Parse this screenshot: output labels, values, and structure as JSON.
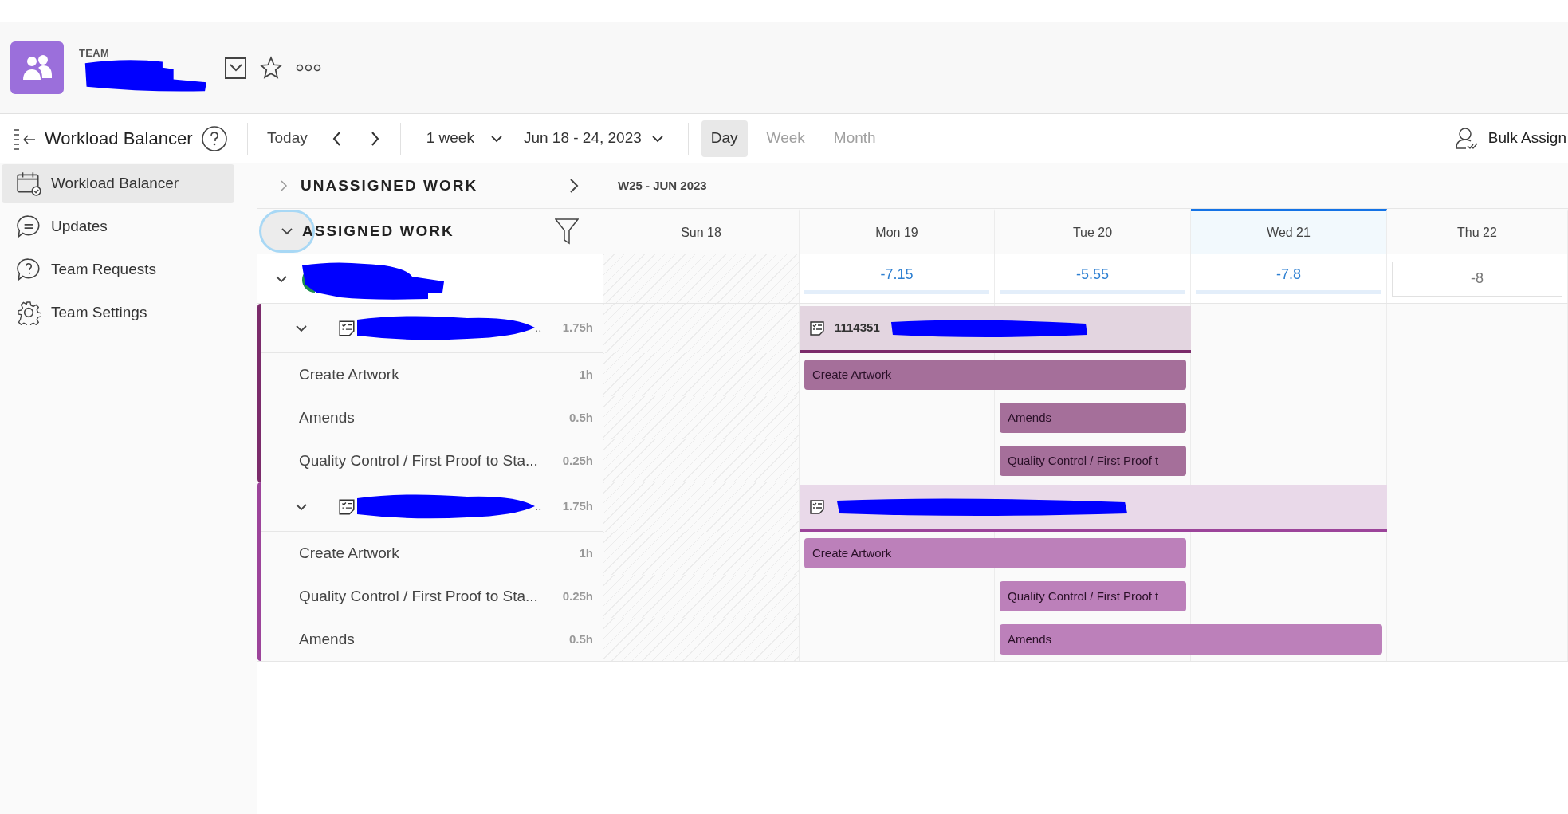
{
  "header": {
    "team_label": "TEAM"
  },
  "toolbar": {
    "title": "Workload Balancer",
    "today": "Today",
    "range": "1 week",
    "dates": "Jun 18 - 24, 2023",
    "views": [
      {
        "label": "Day",
        "selected": true
      },
      {
        "label": "Week",
        "selected": false
      },
      {
        "label": "Month",
        "selected": false
      }
    ],
    "bulk_assign": "Bulk Assign"
  },
  "sidebar": {
    "items": [
      {
        "label": "Workload Balancer",
        "selected": true
      },
      {
        "label": "Updates",
        "selected": false
      },
      {
        "label": "Team Requests",
        "selected": false
      },
      {
        "label": "Team Settings",
        "selected": false
      }
    ]
  },
  "sections": {
    "unassigned": "UNASSIGNED WORK",
    "assigned": "ASSIGNED WORK"
  },
  "timeline": {
    "week": "W25 - JUN 2023",
    "days": [
      {
        "label": "Sun 18",
        "weekend": true,
        "selected": false
      },
      {
        "label": "Mon 19",
        "weekend": false,
        "selected": false,
        "capacity": "-7.15",
        "kind": "allocated"
      },
      {
        "label": "Tue 20",
        "weekend": false,
        "selected": false,
        "capacity": "-5.55",
        "kind": "allocated"
      },
      {
        "label": "Wed 21",
        "weekend": false,
        "selected": true,
        "capacity": "-7.8",
        "kind": "allocated"
      },
      {
        "label": "Thu 22",
        "weekend": false,
        "selected": false,
        "capacity": "-8",
        "kind": "empty"
      }
    ]
  },
  "projects": [
    {
      "color": "#7b2b6b",
      "ellipsis": "..",
      "hours": "1.75h",
      "bar_id": "1114351",
      "covers": [
        false,
        true,
        true,
        false,
        false
      ],
      "tasks": [
        {
          "name": "Create Artwork",
          "hours": "1h",
          "bar": "Create Artwork",
          "covers": [
            false,
            true,
            true,
            false,
            false
          ]
        },
        {
          "name": "Amends",
          "hours": "0.5h",
          "bar": "Amends",
          "covers": [
            false,
            false,
            true,
            false,
            false
          ]
        },
        {
          "name": "Quality Control / First Proof to Sta...",
          "hours": "0.25h",
          "bar": "Quality Control / First Proof t",
          "covers": [
            false,
            false,
            true,
            false,
            false
          ]
        }
      ]
    },
    {
      "color": "#9c449a",
      "ellipsis": "..",
      "hours": "1.75h",
      "covers": [
        false,
        true,
        true,
        true,
        false
      ],
      "tasks": [
        {
          "name": "Create Artwork",
          "hours": "1h",
          "bar": "Create Artwork",
          "covers": [
            false,
            true,
            true,
            false,
            false
          ]
        },
        {
          "name": "Quality Control / First Proof to Sta...",
          "hours": "0.25h",
          "bar": "Quality Control / First Proof t",
          "covers": [
            false,
            false,
            true,
            false,
            false
          ]
        },
        {
          "name": "Amends",
          "hours": "0.5h",
          "bar": "Amends",
          "covers": [
            false,
            false,
            true,
            true,
            false
          ]
        }
      ]
    }
  ]
}
